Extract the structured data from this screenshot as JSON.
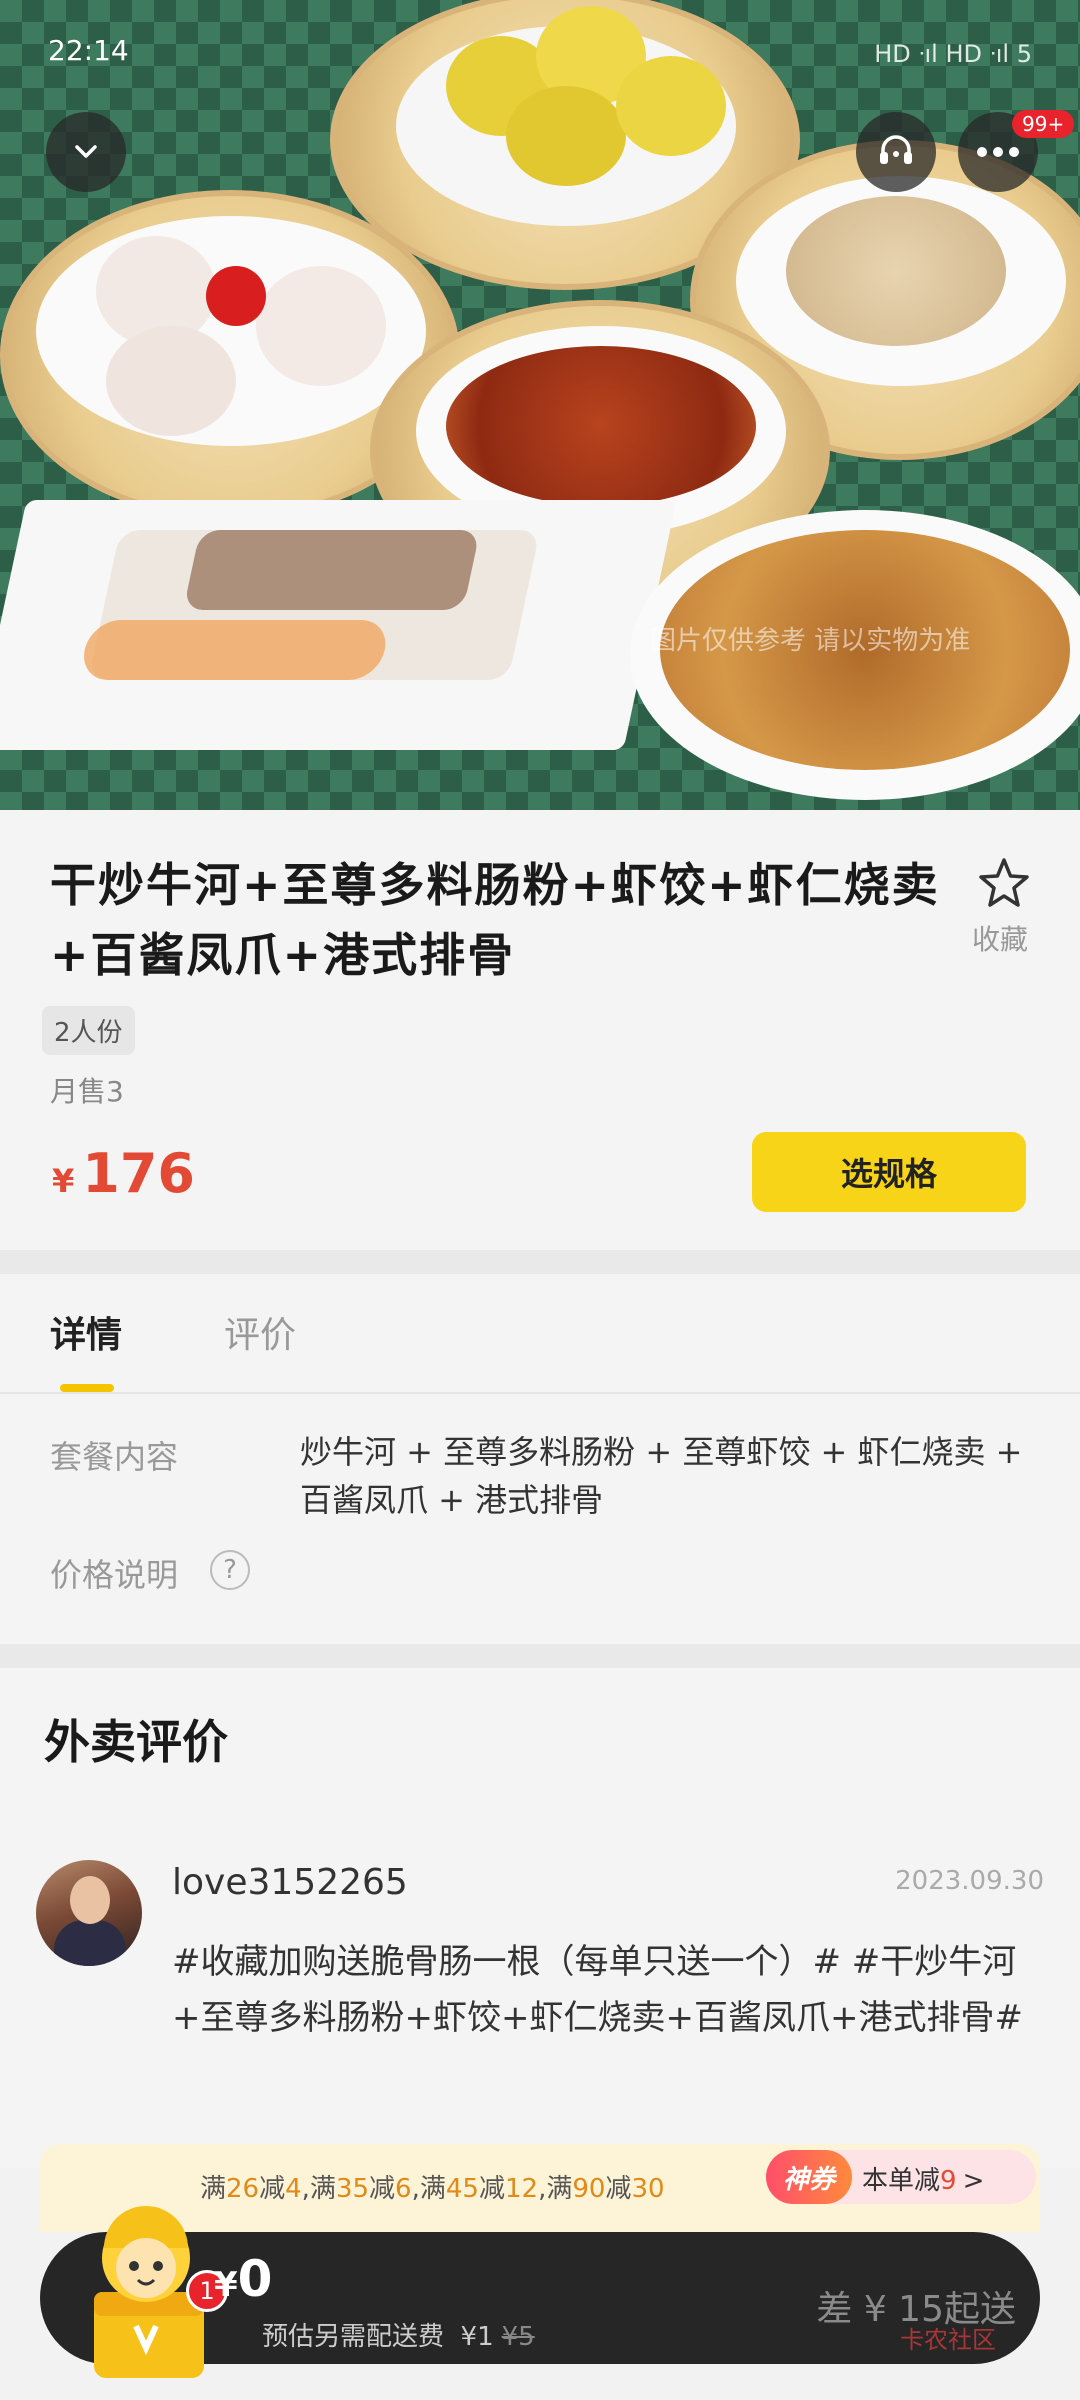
{
  "status_bar": {
    "time": "22:14",
    "indicators": "HD ᐧıl HD ᐧıl 5"
  },
  "hero": {
    "watermark": "图片仅供参考 请以实物为准",
    "more_badge": "99+"
  },
  "product": {
    "title": "干炒牛河+至尊多料肠粉+虾饺+虾仁烧卖+百酱凤爪+港式排骨",
    "favorite_label": "收藏",
    "portion_tag": "2人份",
    "monthly_sales": "月售3",
    "price_currency": "¥",
    "price": "176",
    "select_spec_label": "选规格"
  },
  "tabs": {
    "detail": "详情",
    "review": "评价"
  },
  "details": {
    "combo_label": "套餐内容",
    "combo_value": "炒牛河 + 至尊多料肠粉 + 至尊虾饺 + 虾仁烧卖 + 百酱凤爪 + 港式排骨",
    "price_note_label": "价格说明",
    "help_glyph": "?"
  },
  "reviews": {
    "heading": "外卖评价",
    "items": [
      {
        "username": "love3152265",
        "date": "2023.09.30",
        "text": "#收藏加购送脆骨肠一根（每单只送一个）# #干炒牛河+至尊多料肠粉+虾饺+虾仁烧卖+百酱凤爪+港式排骨#"
      }
    ]
  },
  "promo": {
    "segments": [
      {
        "t": "满",
        "hl": false
      },
      {
        "t": "26",
        "hl": true
      },
      {
        "t": "减",
        "hl": false
      },
      {
        "t": "4",
        "hl": true
      },
      {
        "t": ",满",
        "hl": false
      },
      {
        "t": "35",
        "hl": true
      },
      {
        "t": "减",
        "hl": false
      },
      {
        "t": "6",
        "hl": true
      },
      {
        "t": ",满",
        "hl": false
      },
      {
        "t": "45",
        "hl": true
      },
      {
        "t": "减",
        "hl": false
      },
      {
        "t": "12",
        "hl": true
      },
      {
        "t": ",满",
        "hl": false
      },
      {
        "t": "90",
        "hl": true
      },
      {
        "t": "减",
        "hl": false
      },
      {
        "t": "30",
        "hl": true
      }
    ],
    "coupon_badge": "神券",
    "coupon_text_prefix": "本单减",
    "coupon_amount": "9",
    "coupon_arrow": ">"
  },
  "cart": {
    "currency": "¥",
    "total": "0",
    "fee_label": "预估另需配送费",
    "fee_price": "¥1",
    "fee_original": "¥5",
    "min_order": "差 ¥ 15起送",
    "mascot_badge": "1"
  },
  "corner_watermark": "卡农社区",
  "colors": {
    "accent_yellow": "#f8d418",
    "price_red": "#e24a35",
    "tab_indicator": "#f4c400",
    "cart_bg": "#262626"
  }
}
